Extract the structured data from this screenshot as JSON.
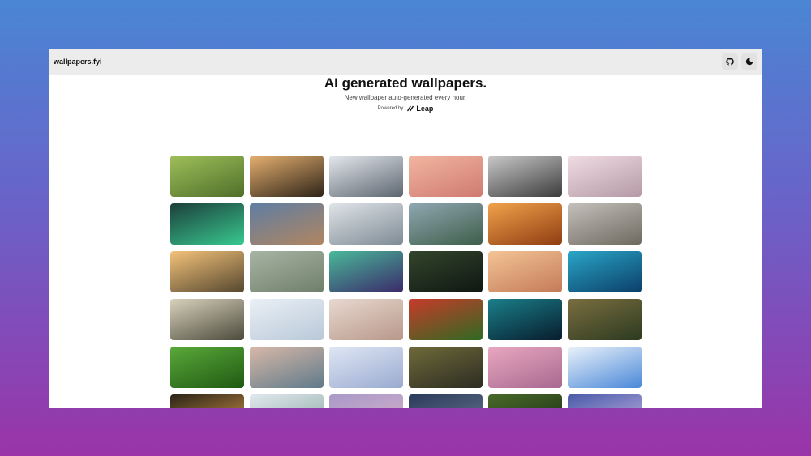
{
  "header": {
    "brand": "wallpapers.fyi"
  },
  "hero": {
    "title": "AI generated wallpapers.",
    "subtitle": "New wallpaper auto-generated every hour.",
    "powered_label": "Powered by",
    "powered_brand": "Leap"
  },
  "icons": {
    "github": "github-icon",
    "theme": "moon-icon",
    "leap": "leap-logo-icon"
  },
  "tiles": [
    {
      "c1": "#9fbf5a",
      "c2": "#4f6f2a"
    },
    {
      "c1": "#e6b070",
      "c2": "#2e2418"
    },
    {
      "c1": "#e4e8ee",
      "c2": "#5d6670"
    },
    {
      "c1": "#f1b6a0",
      "c2": "#d07a70"
    },
    {
      "c1": "#c9c9c9",
      "c2": "#3c3c3c"
    },
    {
      "c1": "#f0dce4",
      "c2": "#b49aa6"
    },
    {
      "c1": "#1c3f3a",
      "c2": "#38c890"
    },
    {
      "c1": "#5f7ea3",
      "c2": "#b08560"
    },
    {
      "c1": "#dfe4e8",
      "c2": "#7f8b95"
    },
    {
      "c1": "#8fa7b2",
      "c2": "#3f5e4a"
    },
    {
      "c1": "#f1a24a",
      "c2": "#8f3d12"
    },
    {
      "c1": "#c4c0bb",
      "c2": "#6e6960"
    },
    {
      "c1": "#f3c27a",
      "c2": "#55472f"
    },
    {
      "c1": "#a8b4a4",
      "c2": "#6f7f6a"
    },
    {
      "c1": "#4ab89a",
      "c2": "#3a2a6a"
    },
    {
      "c1": "#33452c",
      "c2": "#0f1712"
    },
    {
      "c1": "#f3c496",
      "c2": "#c47a58"
    },
    {
      "c1": "#2aa6c8",
      "c2": "#0b3e68"
    },
    {
      "c1": "#d8d2bc",
      "c2": "#4c4a3c"
    },
    {
      "c1": "#eaf0f6",
      "c2": "#b9c8d8"
    },
    {
      "c1": "#e8d8d0",
      "c2": "#b8988a"
    },
    {
      "c1": "#c83a2a",
      "c2": "#2f6a22"
    },
    {
      "c1": "#1a7f8a",
      "c2": "#081c2c"
    },
    {
      "c1": "#7a6e40",
      "c2": "#2c3a20"
    },
    {
      "c1": "#5aa83a",
      "c2": "#1f5a12"
    },
    {
      "c1": "#d8b8a8",
      "c2": "#5f7a8a"
    },
    {
      "c1": "#dfe6f4",
      "c2": "#9aaad0"
    },
    {
      "c1": "#6f6a3a",
      "c2": "#2c2c22"
    },
    {
      "c1": "#e8a8c0",
      "c2": "#a86890"
    },
    {
      "c1": "#eaf2fa",
      "c2": "#4a88d8"
    },
    {
      "c1": "#2a2418",
      "c2": "#d89848"
    },
    {
      "c1": "#e0e8ee",
      "c2": "#8aa6a0"
    },
    {
      "c1": "#a89ac8",
      "c2": "#d8b0c8"
    },
    {
      "c1": "#2a3a5a",
      "c2": "#6a7a90"
    },
    {
      "c1": "#4a6a2a",
      "c2": "#1a2a12"
    },
    {
      "c1": "#4a5aa8",
      "c2": "#c8b8e8"
    }
  ]
}
